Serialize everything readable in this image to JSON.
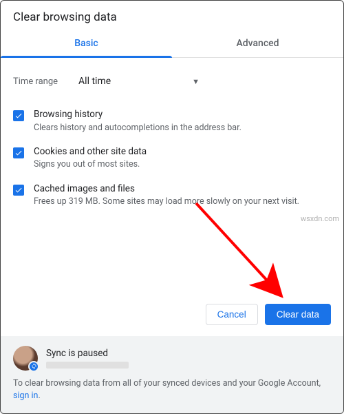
{
  "title": "Clear browsing data",
  "tabs": {
    "basic": "Basic",
    "advanced": "Advanced"
  },
  "timerange": {
    "label": "Time range",
    "value": "All time"
  },
  "options": [
    {
      "title": "Browsing history",
      "desc": "Clears history and autocompletions in the address bar."
    },
    {
      "title": "Cookies and other site data",
      "desc": "Signs you out of most sites."
    },
    {
      "title": "Cached images and files",
      "desc": "Frees up 319 MB. Some sites may load more slowly on your next visit."
    }
  ],
  "actions": {
    "cancel": "Cancel",
    "clear": "Clear data"
  },
  "sync": {
    "status": "Sync is paused",
    "note": "To clear browsing data from all of your synced devices and your Google Account, ",
    "link": "sign in",
    "period": "."
  },
  "watermark": "wsxdn.com"
}
